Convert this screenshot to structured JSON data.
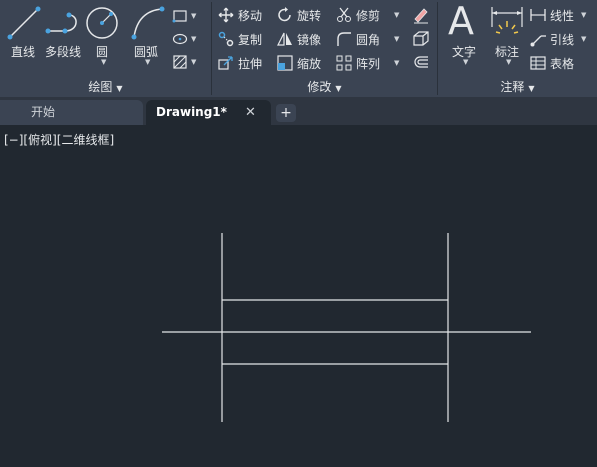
{
  "ribbon": {
    "draw": {
      "title": "绘图",
      "line": "直线",
      "polyline": "多段线",
      "circle": "圆",
      "arc": "圆弧"
    },
    "modify": {
      "title": "修改",
      "move": "移动",
      "rotate": "旋转",
      "trim": "修剪",
      "copy": "复制",
      "mirror": "镜像",
      "fillet": "圆角",
      "stretch": "拉伸",
      "scale": "缩放",
      "array": "阵列"
    },
    "annotation": {
      "title": "注释",
      "text": "文字",
      "dimension": "标注",
      "linear": "线性",
      "leader": "引线",
      "table": "表格"
    }
  },
  "tabs": {
    "start": "开始",
    "drawing": "Drawing1*",
    "close_glyph": "✕",
    "add_glyph": "+"
  },
  "viewport": {
    "label": "[−][俯视][二维线框]"
  },
  "colors": {
    "ribbon_bg": "#3b4453",
    "canvas_bg": "#212830",
    "accent": "#4aa3df",
    "drawing_line": "#e4e6e8"
  },
  "icons": [
    "line-icon",
    "polyline-icon",
    "circle-icon",
    "arc-icon",
    "rectangle-icon",
    "ellipse-icon",
    "hatch-icon",
    "move-icon",
    "rotate-icon",
    "trim-icon",
    "copy-icon",
    "mirror-icon",
    "fillet-icon",
    "stretch-icon",
    "scale-icon",
    "array-icon",
    "erase-icon",
    "3d-box-icon",
    "offset-icon",
    "text-icon",
    "dimension-icon",
    "linear-dim-icon",
    "leader-icon",
    "table-icon"
  ]
}
